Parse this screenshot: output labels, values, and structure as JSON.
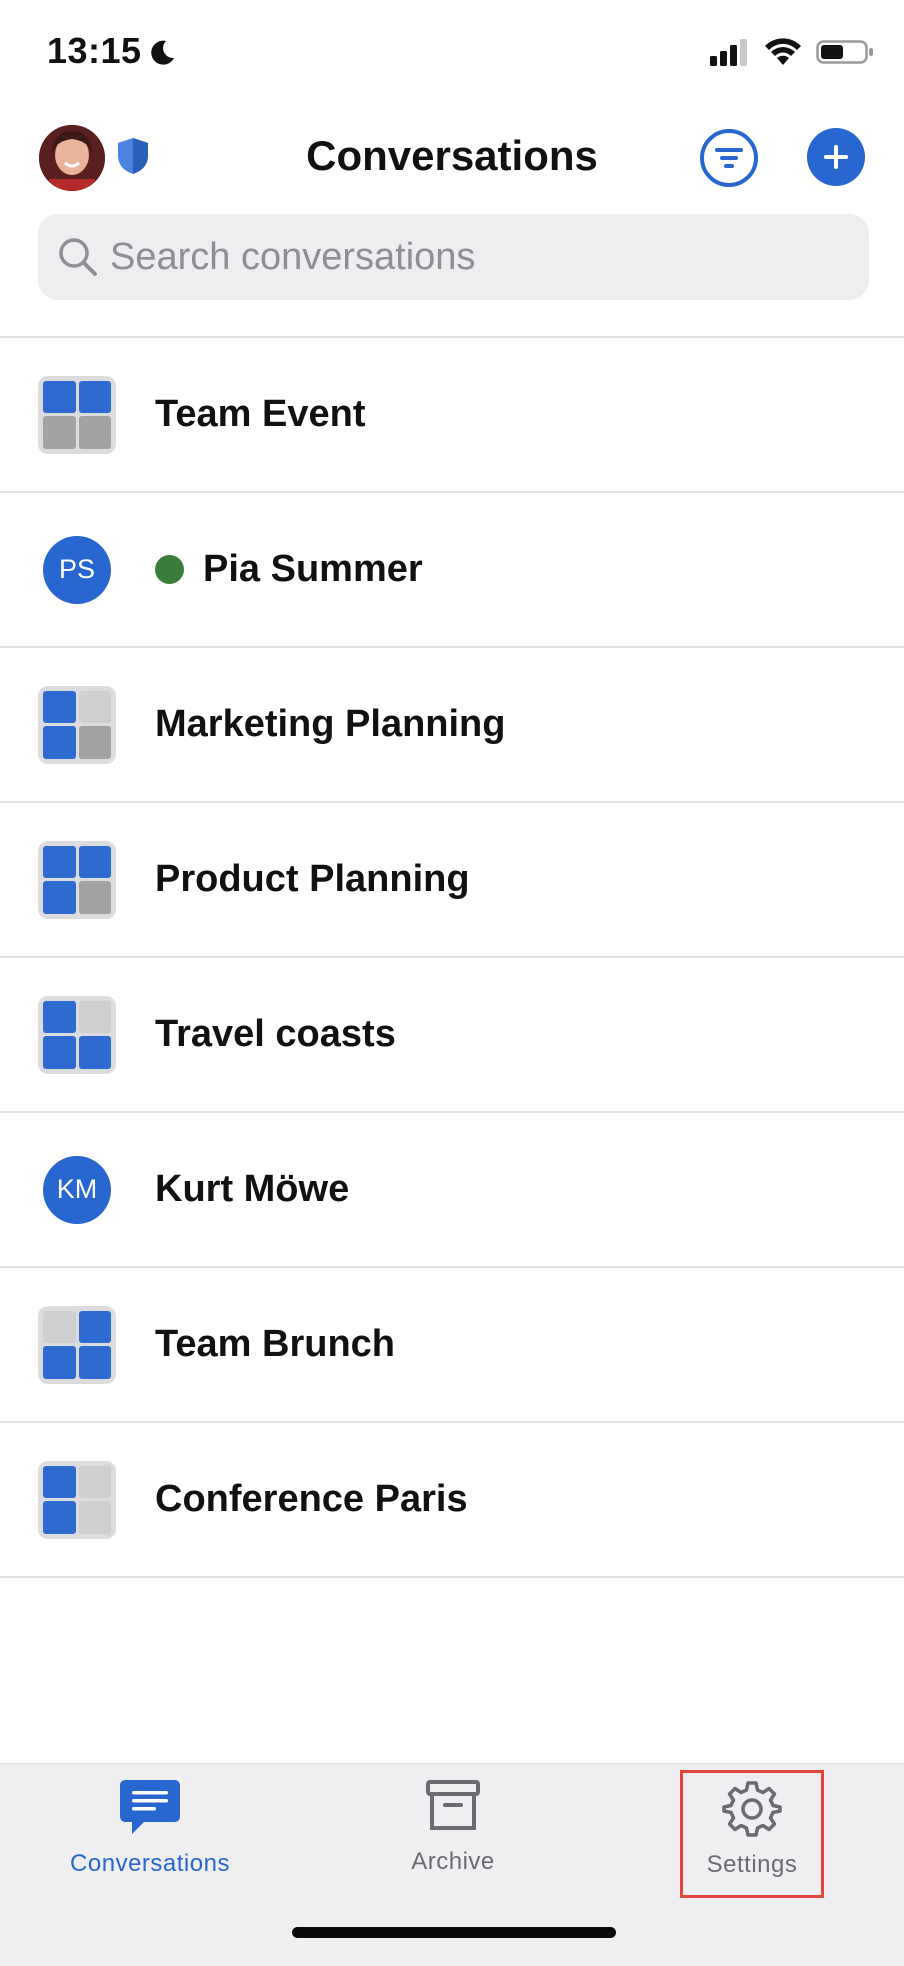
{
  "status_bar": {
    "time": "13:15"
  },
  "header": {
    "title": "Conversations"
  },
  "search": {
    "placeholder": "Search conversations"
  },
  "conversations": [
    {
      "name": "Team Event",
      "kind": "group"
    },
    {
      "name": "Pia Summer",
      "kind": "person",
      "initials": "PS",
      "online": true
    },
    {
      "name": "Marketing Planning",
      "kind": "group"
    },
    {
      "name": "Product Planning",
      "kind": "group"
    },
    {
      "name": "Travel coasts",
      "kind": "group"
    },
    {
      "name": "Kurt Möwe",
      "kind": "person",
      "initials": "KM"
    },
    {
      "name": "Team Brunch",
      "kind": "group"
    },
    {
      "name": "Conference Paris",
      "kind": "group"
    }
  ],
  "tabbar": {
    "conversations_label": "Conversations",
    "archive_label": "Archive",
    "settings_label": "Settings",
    "active_tab": "conversations"
  },
  "colors": {
    "accent": "#2867d0",
    "online": "#3a7d3a",
    "highlight_border": "#e0473a"
  }
}
